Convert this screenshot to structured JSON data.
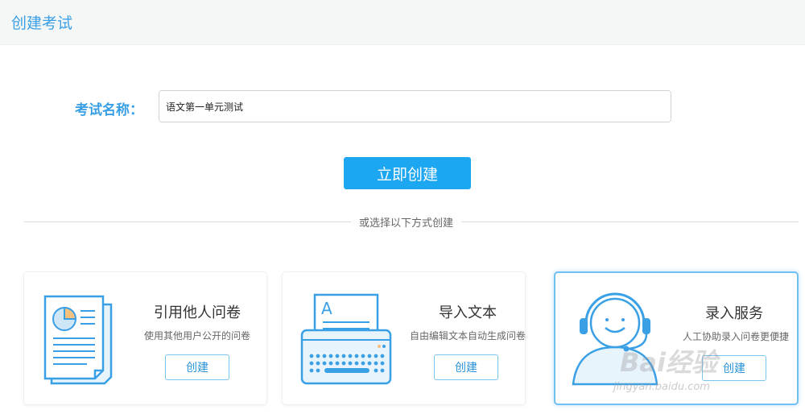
{
  "header": {
    "title": "创建考试"
  },
  "form": {
    "name_label": "考试名称：",
    "name_value": "语文第一单元测试"
  },
  "actions": {
    "create_label": "立即创建"
  },
  "divider": {
    "text": "或选择以下方式创建"
  },
  "cards": [
    {
      "title": "引用他人问卷",
      "desc": "使用其他用户公开的问卷",
      "button": "创建",
      "icon": "document-pie-chart-icon"
    },
    {
      "title": "导入文本",
      "desc": "自由编辑文本自动生成问卷",
      "button": "创建",
      "icon": "typewriter-icon"
    },
    {
      "title": "录入服务",
      "desc": "人工协助录入问卷更便捷",
      "button": "创建",
      "icon": "headset-agent-icon"
    }
  ],
  "watermark": {
    "main": "Bai经验",
    "sub": "jingyan.baidu.com"
  },
  "colors": {
    "accent": "#1ea7f1",
    "title_blue": "#3aa0e6",
    "icon_blue": "#3aa0e6",
    "icon_fill": "#e8f4fc",
    "pie_orange": "#f7c07d"
  }
}
